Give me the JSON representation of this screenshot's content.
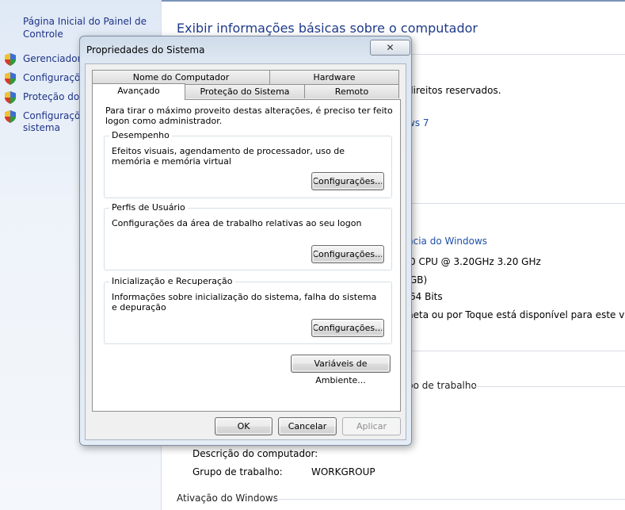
{
  "control_panel": {
    "home": "Página Inicial do Painel de Controle",
    "links": [
      "Gerenciador d",
      "Configuraçõe",
      "Proteção do s",
      "Configuraçõe"
    ],
    "link_last_line2": "sistema",
    "title": "Exibir informações básicas sobre o computador",
    "rights": "direitos reservados.",
    "win_ver": "ws 7",
    "rating_link": "ncia do Windows",
    "cpu": "0 CPU @ 3.20GHz   3.20 GHz",
    "ram": "GB)",
    "os_type": "64 Bits",
    "pen": "neta ou por Toque está disponível para este vídeo",
    "workgroup_section": "po de trabalho",
    "description_label": "Descrição do computador:",
    "workgroup_label": "Grupo de trabalho:",
    "workgroup_value": "WORKGROUP",
    "activation": "Ativação do Windows"
  },
  "dialog": {
    "title": "Propriedades do Sistema",
    "close_glyph": "✕",
    "tabs_back": [
      "Nome do Computador",
      "Hardware"
    ],
    "tabs_front": [
      "Avançado",
      "Proteção do Sistema",
      "Remoto"
    ],
    "intro": "Para tirar o máximo proveito destas alterações, é preciso ter feito logon como administrador.",
    "groups": [
      {
        "title": "Desempenho",
        "desc": "Efeitos visuais, agendamento de processador, uso de memória e memória virtual",
        "button": "Configurações..."
      },
      {
        "title": "Perfis de Usuário",
        "desc": "Configurações da área de trabalho relativas ao seu logon",
        "button": "Configurações..."
      },
      {
        "title": "Inicialização e Recuperação",
        "desc": "Informações sobre inicialização do sistema, falha do sistema e depuração",
        "button": "Configurações..."
      }
    ],
    "env_button": "Variáveis de Ambiente...",
    "ok": "OK",
    "cancel": "Cancelar",
    "apply": "Aplicar"
  },
  "colors": {
    "link": "#1e3287",
    "annotation_arrow": "#e01818"
  }
}
